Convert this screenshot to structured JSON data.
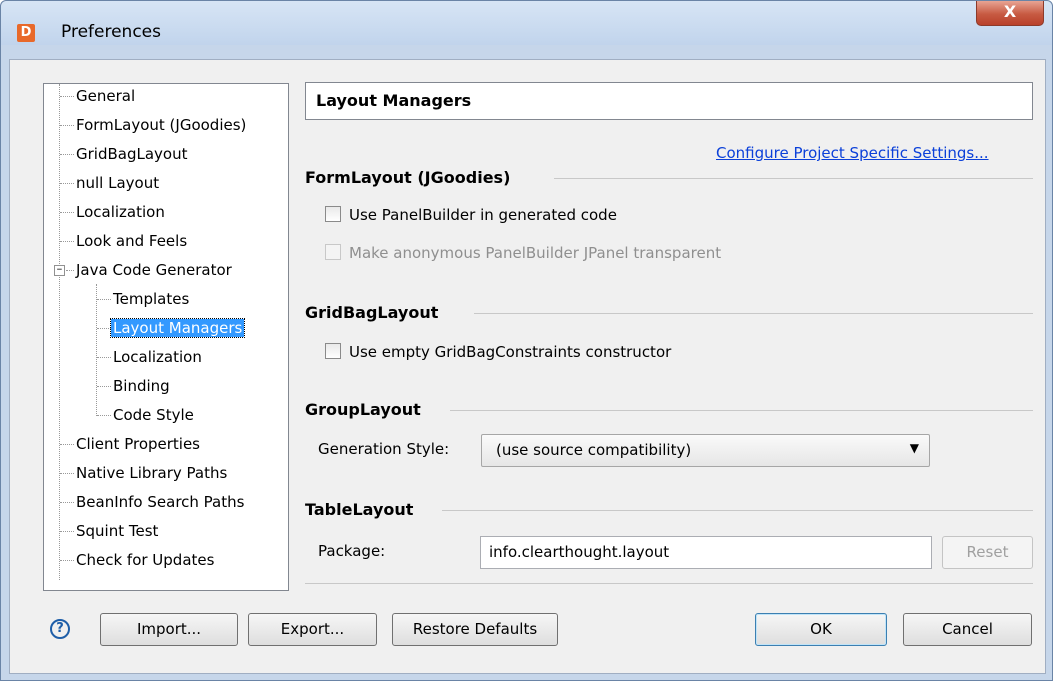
{
  "window": {
    "title": "Preferences",
    "close_label": "X",
    "app_icon_glyph": "D"
  },
  "tree": {
    "items": [
      {
        "label": "General"
      },
      {
        "label": "FormLayout (JGoodies)"
      },
      {
        "label": "GridBagLayout"
      },
      {
        "label": "null Layout"
      },
      {
        "label": "Localization"
      },
      {
        "label": "Look and Feels"
      },
      {
        "label": "Java Code Generator",
        "expander": "−"
      },
      {
        "label": "Templates"
      },
      {
        "label": "Layout Managers",
        "selected": true
      },
      {
        "label": "Localization"
      },
      {
        "label": "Binding"
      },
      {
        "label": "Code Style"
      },
      {
        "label": "Client Properties"
      },
      {
        "label": "Native Library Paths"
      },
      {
        "label": "BeanInfo Search Paths"
      },
      {
        "label": "Squint Test"
      },
      {
        "label": "Check for Updates"
      }
    ]
  },
  "page": {
    "title": "Layout Managers",
    "configure_link": "Configure Project Specific Settings..."
  },
  "formlayout": {
    "title": "FormLayout (JGoodies)",
    "use_panelbuilder": "Use PanelBuilder in generated code",
    "anon_transparent": "Make anonymous PanelBuilder JPanel transparent"
  },
  "gridbag": {
    "title": "GridBagLayout",
    "empty_constraints": "Use empty GridBagConstraints constructor"
  },
  "grouplayout": {
    "title": "GroupLayout",
    "generation_style_label": "Generation Style:",
    "generation_style_value": "(use source compatibility)",
    "dropdown_arrow": "▼"
  },
  "tablelayout": {
    "title": "TableLayout",
    "package_label": "Package:",
    "package_value": "info.clearthought.layout",
    "reset_label": "Reset"
  },
  "buttons": {
    "help_glyph": "?",
    "import": "Import...",
    "export": "Export...",
    "restore": "Restore Defaults",
    "ok": "OK",
    "cancel": "Cancel"
  },
  "colors": {
    "selection": "#3399ff",
    "link": "#0b40d9",
    "close": "#c75a42"
  }
}
